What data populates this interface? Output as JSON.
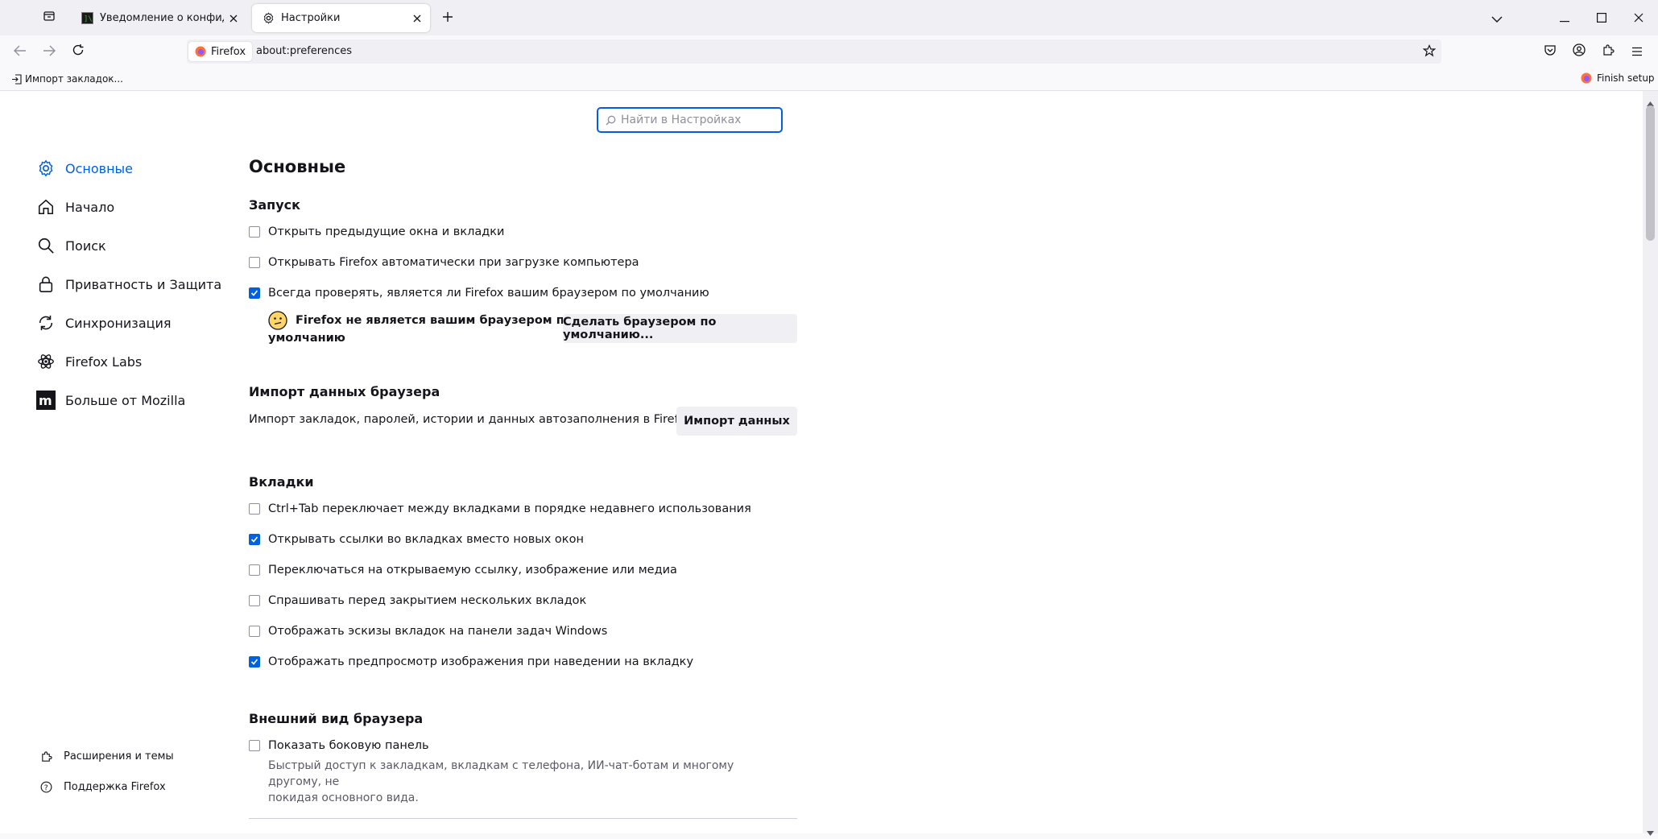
{
  "tabs": [
    {
      "label": "Уведомление о конфиденциа",
      "icon": "terminal-icon",
      "active": false
    },
    {
      "label": "Настройки",
      "icon": "gear-icon",
      "active": true
    }
  ],
  "identity_label": "Firefox",
  "url": "about:preferences",
  "bookmarks": {
    "import_label": "Импорт закладок...",
    "finish_setup": "Finish setup"
  },
  "search": {
    "placeholder": "Найти в Настройках"
  },
  "categories": [
    {
      "label": "Основные",
      "icon": "gear-icon",
      "selected": true
    },
    {
      "label": "Начало",
      "icon": "home-icon"
    },
    {
      "label": "Поиск",
      "icon": "search-icon"
    },
    {
      "label": "Приватность и Защита",
      "icon": "lock-icon"
    },
    {
      "label": "Синхронизация",
      "icon": "sync-icon"
    },
    {
      "label": "Firefox Labs",
      "icon": "labs-icon"
    },
    {
      "label": "Больше от Mozilla",
      "icon": "mozilla-icon"
    }
  ],
  "footer": {
    "extensions": "Расширения и темы",
    "support": "Поддержка Firefox"
  },
  "page_title": "Основные",
  "startup": {
    "heading": "Запуск",
    "items": [
      {
        "label": "Открыть предыдущие окна и вкладки",
        "checked": false
      },
      {
        "label": "Открывать Firefox автоматически при загрузке компьютера",
        "checked": false
      },
      {
        "label": "Всегда проверять, является ли Firefox вашим браузером по умолчанию",
        "checked": true
      }
    ],
    "default_status_line1": "Firefox не является вашим браузером по",
    "default_status_line2": "умолчанию",
    "make_default_button": "Сделать браузером по умолчанию..."
  },
  "import": {
    "heading": "Импорт данных браузера",
    "description": "Импорт закладок, паролей, истории и данных автозаполнения в Firefox.",
    "button": "Импорт данных"
  },
  "tabs_section": {
    "heading": "Вкладки",
    "items": [
      {
        "label": "Ctrl+Tab переключает между вкладками в порядке недавнего использования",
        "checked": false
      },
      {
        "label": "Открывать ссылки во вкладках вместо новых окон",
        "checked": true
      },
      {
        "label": "Переключаться на открываемую ссылку, изображение или медиа",
        "checked": false
      },
      {
        "label": "Спрашивать перед закрытием нескольких вкладок",
        "checked": false
      },
      {
        "label": "Отображать эскизы вкладок на панели задач Windows",
        "checked": false
      },
      {
        "label": "Отображать предпросмотр изображения при наведении на вкладку",
        "checked": true
      }
    ]
  },
  "appearance": {
    "heading": "Внешний вид браузера",
    "sidebar_label": "Показать боковую панель",
    "sidebar_checked": false,
    "sidebar_desc_line1": "Быстрый доступ к закладкам, вкладкам с телефона, ИИ-чат-ботам и многому другому, не",
    "sidebar_desc_line2": "покидая основного вида."
  }
}
